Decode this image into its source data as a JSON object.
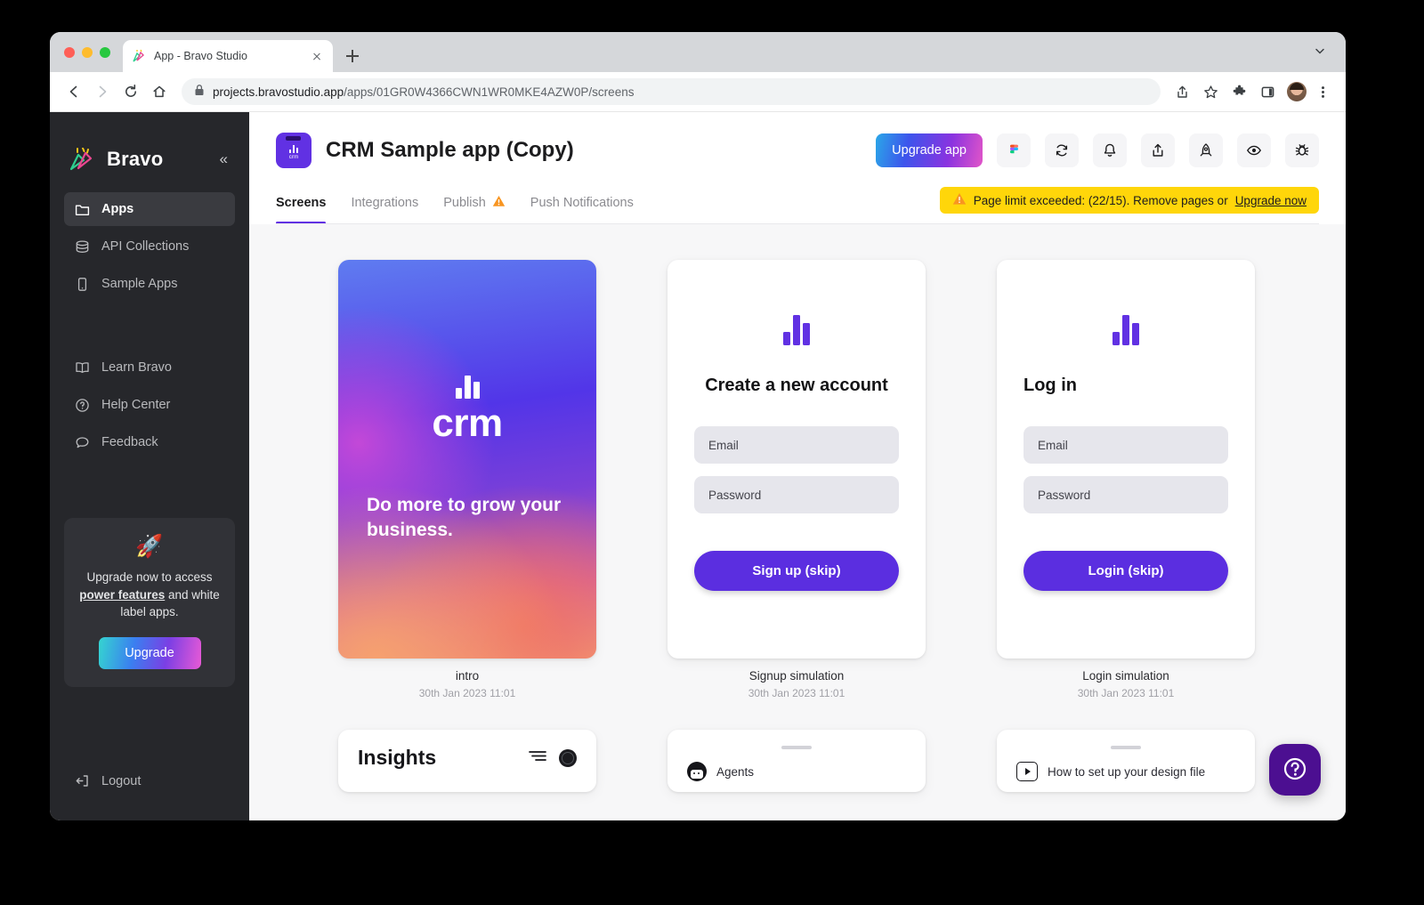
{
  "browser": {
    "tab": {
      "title": "App - Bravo Studio",
      "favicon": "bravo-confetti-icon"
    },
    "new_tab_label": "+",
    "url_host": "projects.bravostudio.app",
    "url_path": "/apps/01GR0W4366CWN1WR0MKE4AZW0P/screens",
    "nav": {
      "back": "back-arrow",
      "forward": "forward-arrow",
      "reload": "reload",
      "home": "home"
    },
    "actions": [
      "share-icon",
      "bookmark-star-icon",
      "extensions-puzzle-icon",
      "side-panel-icon",
      "profile-avatar"
    ]
  },
  "sidebar": {
    "brand": "Bravo",
    "collapse_label": "«",
    "primary_items": [
      {
        "label": "Apps",
        "icon": "folder-icon",
        "active": true
      },
      {
        "label": "API Collections",
        "icon": "database-icon",
        "active": false
      },
      {
        "label": "Sample Apps",
        "icon": "phone-icon",
        "active": false
      }
    ],
    "secondary_items": [
      {
        "label": "Learn Bravo",
        "icon": "book-icon"
      },
      {
        "label": "Help Center",
        "icon": "question-circle-icon"
      },
      {
        "label": "Feedback",
        "icon": "chat-bubble-icon"
      }
    ],
    "promo": {
      "emoji": "🚀",
      "text_before": "Upgrade now to access ",
      "text_bold": "power features",
      "text_after": " and white label apps.",
      "button": "Upgrade"
    },
    "logout": {
      "label": "Logout",
      "icon": "logout-icon"
    }
  },
  "header": {
    "app_icon_label": "crm",
    "app_title": "CRM Sample app (Copy)",
    "upgrade_button": "Upgrade app",
    "tools": [
      {
        "name": "figma-icon"
      },
      {
        "name": "sync-icon"
      },
      {
        "name": "bell-icon"
      },
      {
        "name": "share-upload-icon"
      },
      {
        "name": "rocket-icon"
      },
      {
        "name": "eye-icon"
      },
      {
        "name": "bug-icon"
      }
    ],
    "tabs": [
      {
        "label": "Screens",
        "active": true,
        "warning": false
      },
      {
        "label": "Integrations",
        "active": false,
        "warning": false
      },
      {
        "label": "Publish",
        "active": false,
        "warning": true
      },
      {
        "label": "Push Notifications",
        "active": false,
        "warning": false
      }
    ],
    "banner": {
      "icon": "warning-triangle-icon",
      "text": "Page limit exceeded: (22/15). Remove pages or ",
      "link": "Upgrade now"
    }
  },
  "screens": {
    "intro": {
      "name": "intro",
      "date": "30th Jan 2023 11:01",
      "logo_word": "crm",
      "tagline": "Do more to grow your business."
    },
    "signup": {
      "name": "Signup simulation",
      "date": "30th Jan 2023 11:01",
      "title": "Create a new account",
      "email_placeholder": "Email",
      "password_placeholder": "Password",
      "submit": "Sign up (skip)"
    },
    "login": {
      "name": "Login simulation",
      "date": "30th Jan 2023 11:01",
      "title": "Log in",
      "email_placeholder": "Email",
      "password_placeholder": "Password",
      "submit": "Login (skip)"
    },
    "insights": {
      "title": "Insights"
    },
    "agents": {
      "title": "Agents"
    },
    "design_file": {
      "title": "How to set up your design file"
    }
  },
  "help_fab": {
    "icon": "question-mark-icon"
  },
  "colors": {
    "accent_purple": "#6131e3",
    "button_purple": "#5b2ee0",
    "banner_yellow": "#ffd60a",
    "sidebar_bg": "#26272b",
    "help_fab": "#4c0f91"
  }
}
